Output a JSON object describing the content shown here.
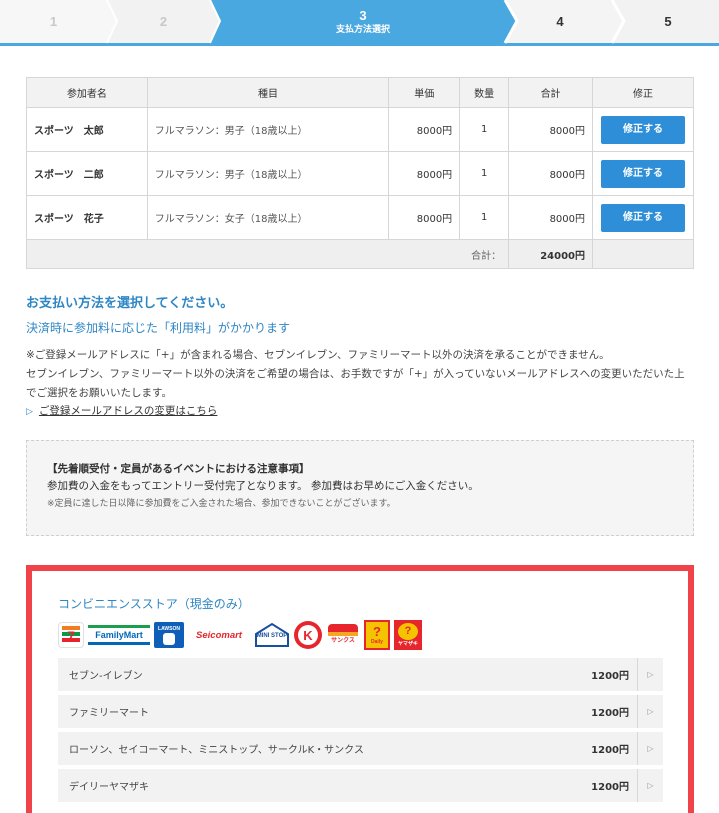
{
  "steps": [
    {
      "num": "1"
    },
    {
      "num": "2"
    },
    {
      "num": "3",
      "label": "支払方法選択"
    },
    {
      "num": "4"
    },
    {
      "num": "5"
    }
  ],
  "table": {
    "headers": [
      "参加者名",
      "種目",
      "単価",
      "数量",
      "合計",
      "修正"
    ],
    "rows": [
      {
        "name": "スポーツ　太郎",
        "item": "フルマラソン：男子（18歳以上）",
        "unit": "8000円",
        "qty": "1",
        "total": "8000円",
        "fix": "修正する"
      },
      {
        "name": "スポーツ　二郎",
        "item": "フルマラソン：男子（18歳以上）",
        "unit": "8000円",
        "qty": "1",
        "total": "8000円",
        "fix": "修正する"
      },
      {
        "name": "スポーツ　花子",
        "item": "フルマラソン：女子（18歳以上）",
        "unit": "8000円",
        "qty": "1",
        "total": "8000円",
        "fix": "修正する"
      }
    ],
    "total_label": "合計：",
    "total_value": "24000円"
  },
  "instructions": {
    "heading": "お支払い方法を選択してください。",
    "subheading": "決済時に参加料に応じた「利用料」がかかります",
    "note1": "※ご登録メールアドレスに「+」が含まれる場合、セブンイレブン、ファミリーマート以外の決済を承ることができません。",
    "note2": "セブンイレブン、ファミリーマート以外の決済をご希望の場合は、お手数ですが「+」が入っていないメールアドレスへの変更いただいた上でご選択をお願いいたします。",
    "link": "ご登録メールアドレスの変更はこちら"
  },
  "notice": {
    "title": "【先着順受付・定員があるイベントにおける注意事項】",
    "body": "参加費の入金をもってエントリー受付完了となります。 参加費はお早めにご入金ください。",
    "small": "※定員に達した日以降に参加費をご入金された場合、参加できないことがございます。"
  },
  "cvs": {
    "title": "コンビニエンスストア（現金のみ）",
    "logos": {
      "seven": "7",
      "familymart": "FamilyMart",
      "lawson": "LAWSON",
      "seicomart": "Seicomart",
      "ministop": "MINI STOP",
      "circlek": "K",
      "sunkus": "サンクス",
      "daily": "Daily",
      "yamazaki": "ヤマザキ"
    },
    "options": [
      {
        "label": "セブン-イレブン",
        "price": "1200円"
      },
      {
        "label": "ファミリーマート",
        "price": "1200円"
      },
      {
        "label": "ローソン、セイコーマート、ミニストップ、サークルK・サンクス",
        "price": "1200円"
      },
      {
        "label": "デイリーヤマザキ",
        "price": "1200円"
      }
    ]
  },
  "colors": {
    "accent": "#2f86c4",
    "step_active": "#4aa8e0",
    "button": "#2e8fd8",
    "cvs_border": "#ef4249"
  }
}
